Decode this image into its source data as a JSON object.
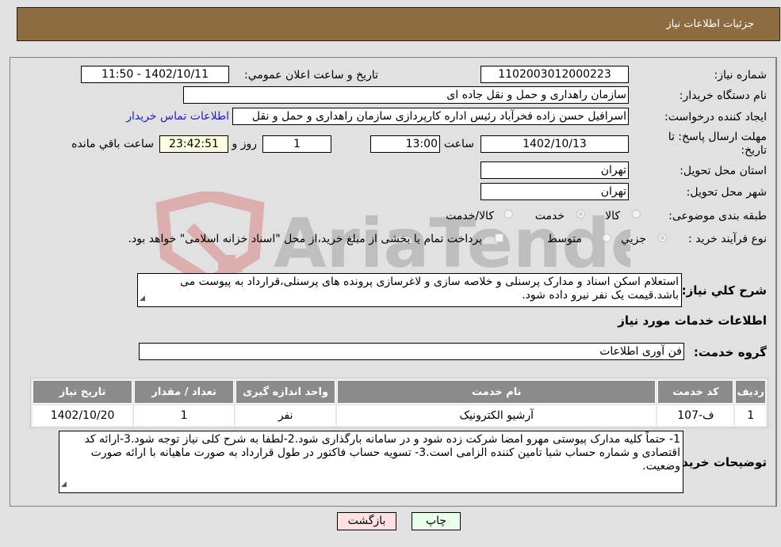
{
  "header": {
    "title": "جزئیات اطلاعات نیاز"
  },
  "fields": {
    "need_number": {
      "label": "شماره نیاز:",
      "value": "1102003012000223"
    },
    "announce_datetime": {
      "label": "تاریخ و ساعت اعلان عمومي:",
      "value": "1402/10/11 - 11:50"
    },
    "buyer_org": {
      "label": "نام دستگاه خریدار:",
      "value": "سازمان راهداری و حمل و نقل جاده ای"
    },
    "requester": {
      "label": "ایجاد کننده درخواست:",
      "value": "اسرافیل حسن زاده فخرآباد رئیس اداره کارپردازی سازمان راهداری و حمل و نقل"
    },
    "buyer_contact_link": "اطلاعات تماس خریدار",
    "deadline": {
      "label": "مهلت ارسال پاسخ: تا تاریخ:",
      "date": "1402/10/13",
      "time_label": "ساعت",
      "time": "13:00",
      "days": "1",
      "days_label": "روز و",
      "remaining": "23:42:51",
      "remaining_label": "ساعت باقي مانده"
    },
    "province": {
      "label": "استان محل تحویل:",
      "value": "تهران"
    },
    "city": {
      "label": "شهر محل تحویل:",
      "value": "تهران"
    },
    "category": {
      "label": "طبقه بندی موضوعی:",
      "options": [
        "کالا",
        "خدمت",
        "کالا/خدمت"
      ],
      "selected": "خدمت"
    },
    "purchase_type": {
      "label": "نوع فرآیند خرید :",
      "options": [
        "جزيي",
        "متوسط"
      ],
      "selected": "جزيي",
      "treasury_note": "پرداخت تمام یا بخشی از مبلغ خرید،از محل \"اسناد خزانه اسلامی\" خواهد بود."
    },
    "general_description": {
      "label": "شرح کلي نیاز:",
      "value": "استعلام اسکن اسناد و مدارک پرسنلی و خلاصه سازی و لاغرسازی پرونده های پرسنلی،قرارداد به پیوست می باشد.قیمت یک نفر نیرو داده شود."
    }
  },
  "services_section": {
    "title": "اطلاعات خدمات مورد نیاز",
    "group_label": "گروه خدمت:",
    "group_value": "فن آوری اطلاعات"
  },
  "table": {
    "columns": [
      "ردیف",
      "کد خدمت",
      "نام خدمت",
      "واحد اندازه گیری",
      "تعداد / مقدار",
      "تاریخ نیاز"
    ],
    "rows": [
      [
        "1",
        "ف-107",
        "آرشیو الکترونیک",
        "نفر",
        "1",
        "1402/10/20"
      ]
    ]
  },
  "buyer_notes": {
    "label": "توضیحات خریدار:",
    "value": "1- حتماً کلیه مدارک پیوستی مهرو امضا شرکت زده شود و در سامانه بارگذاری شود.2-لطفا به شرح کلی نیاز توجه شود.3-ارائه کد اقتصادی و شماره حساب شبا تامین کننده الزامی است.3- تسویه حساب فاکتور در طول قرارداد به صورت ماهیانه با ارائه صورت وضعیت."
  },
  "buttons": {
    "print": "چاپ",
    "back": "بازگشت"
  },
  "watermark": {
    "text": "AriaTender.neT"
  },
  "colors": {
    "header_bg": "#8d6c42",
    "print_bg": "#eaffea",
    "back_bg": "#ffe1e1",
    "link": "#2020c8"
  }
}
